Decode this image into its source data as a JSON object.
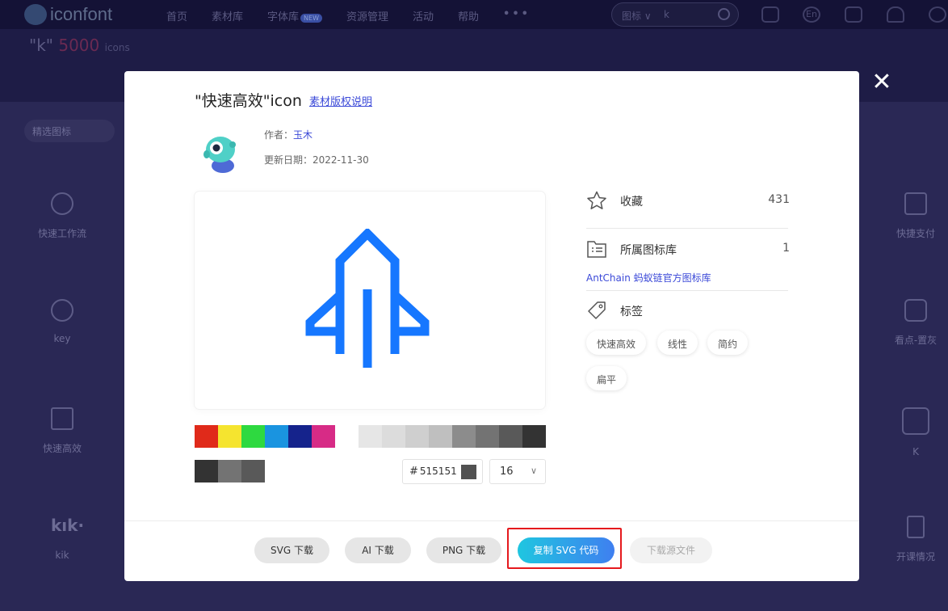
{
  "header": {
    "logo_text": "iconfont",
    "nav": [
      "首页",
      "素材库",
      "字体库",
      "资源管理",
      "活动",
      "帮助"
    ],
    "new_badge": "NEW",
    "more": "•••",
    "search_category": "图标 ∨",
    "search_query": "k",
    "lang": "En"
  },
  "results": {
    "query": "\"k\"",
    "count": "5000",
    "unit": "icons",
    "filter_label": "精选图标"
  },
  "background_cards": [
    {
      "label": "快速工作流"
    },
    {
      "label": "key"
    },
    {
      "label": "快速高效"
    },
    {
      "label": "kik"
    },
    {
      "label": "快捷支付"
    },
    {
      "label": "看点-置灰"
    },
    {
      "label": "K"
    },
    {
      "label": "开课情况"
    }
  ],
  "modal": {
    "title": "\"快速高效\"icon",
    "license_link": "素材版权说明",
    "author_label": "作者：",
    "author_name": "玉木",
    "date_label": "更新日期：",
    "date": "2022-11-30",
    "icon_color": "#1677ff",
    "palette": [
      "#e02a1a",
      "#f5e42f",
      "#2ed940",
      "#1a94e0",
      "#15238c",
      "#d72b86",
      "#ffffff",
      "#e6e6e6",
      "#dcdcdc",
      "#cfcfcf",
      "#bfbfbf",
      "#8c8c8c",
      "#737373",
      "#595959",
      "#333333"
    ],
    "presets": [
      "#333333",
      "#737373",
      "#595959"
    ],
    "hex_hash": "#",
    "hex_value": "515151",
    "size_value": "16",
    "favorite_label": "收藏",
    "favorite_count": "431",
    "library_label": "所属图标库",
    "library_count": "1",
    "library_name": "AntChain 蚂蚁链官方图标库",
    "tags_label": "标签",
    "tags": [
      "快速高效",
      "线性",
      "简约",
      "扁平"
    ],
    "buttons": {
      "svg": "SVG 下载",
      "ai": "AI 下载",
      "png": "PNG 下载",
      "copy_svg": "复制 SVG 代码",
      "source": "下载源文件"
    }
  }
}
